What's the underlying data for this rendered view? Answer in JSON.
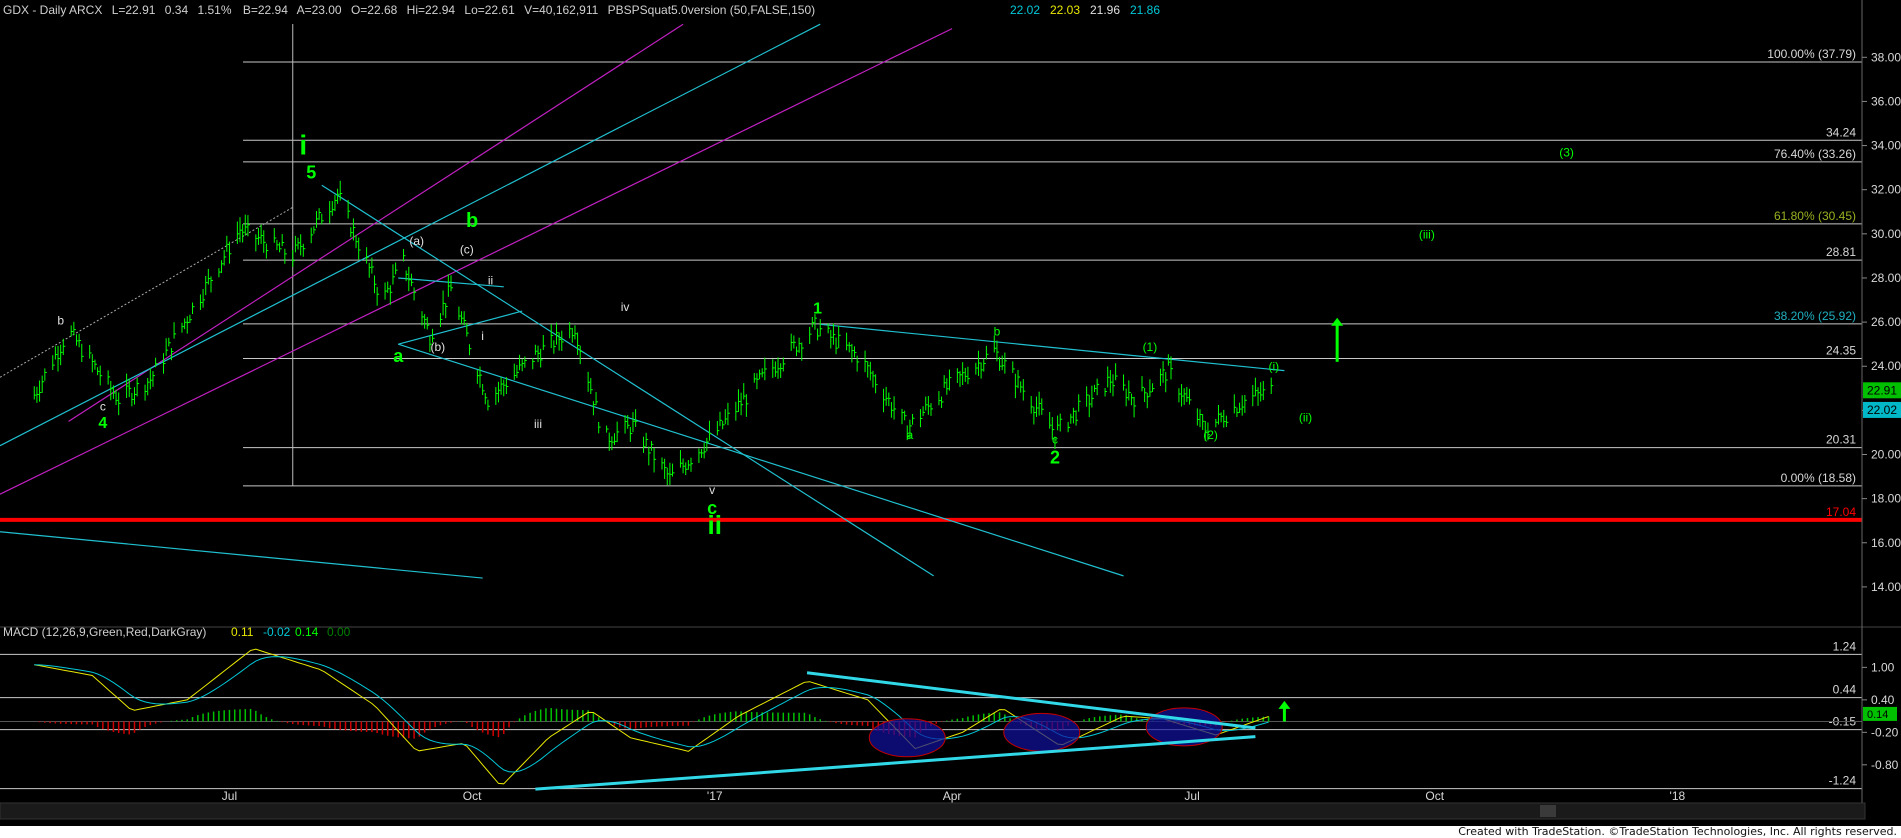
{
  "header": {
    "symbol": "GDX - Daily  ARCX",
    "last": "L=22.91",
    "change": "0.34",
    "change_pct": "1.51%",
    "bid": "B=22.94",
    "ask": "A=23.00",
    "open": "O=22.68",
    "high": "Hi=22.94",
    "low": "Lo=22.61",
    "volume": "V=40,162,911",
    "indicator": "PBSPSquat5.0version (50,FALSE,150)",
    "ind_values": [
      {
        "text": "22.02",
        "color": "#00c8d8"
      },
      {
        "text": "22.03",
        "color": "#e8e800"
      },
      {
        "text": "21.96",
        "color": "#e0e0e0"
      },
      {
        "text": "21.86",
        "color": "#00c8d8"
      }
    ]
  },
  "macd_header": {
    "label": "MACD (12,26,9,Green,Red,DarkGray)",
    "values": [
      {
        "text": "0.11",
        "color": "#e8e800"
      },
      {
        "text": "-0.02",
        "color": "#00c8d8"
      },
      {
        "text": "0.14",
        "color": "#00ff00"
      },
      {
        "text": "0.00",
        "color": "#008000"
      }
    ]
  },
  "footer": {
    "text": "Created with TradeStation. ©TradeStation Technologies, Inc. All rights reserved."
  },
  "colors": {
    "background": "#000000",
    "wave_green": "#00ff00",
    "channel_cyan": "#20c0d0",
    "channel_magenta": "#c020c0",
    "support_red": "#ff0000",
    "fib_white": "#c8c8c8"
  },
  "chart_data": [
    {
      "type": "line",
      "subtype": "ohlc-daily",
      "x_ticks": [
        "Jul",
        "Oct",
        "'17",
        "Apr",
        "Jul",
        "Oct",
        "'18"
      ],
      "y_ticks": [
        14.0,
        16.0,
        18.0,
        20.0,
        22.0,
        24.0,
        26.0,
        28.0,
        30.0,
        32.0,
        34.0,
        36.0,
        38.0
      ],
      "ylim": [
        12.5,
        39.6
      ],
      "price_series_approx": [
        [
          "2016-04-18",
          22.7
        ],
        [
          "2016-05-01",
          25.6
        ],
        [
          "2016-05-20",
          22.5
        ],
        [
          "2016-06-01",
          23.4
        ],
        [
          "2016-06-20",
          27.2
        ],
        [
          "2016-07-05",
          30.2
        ],
        [
          "2016-07-25",
          29.0
        ],
        [
          "2016-08-11",
          31.8
        ],
        [
          "2016-08-28",
          27.0
        ],
        [
          "2016-09-05",
          28.7
        ],
        [
          "2016-09-15",
          25.4
        ],
        [
          "2016-09-23",
          27.5
        ],
        [
          "2016-10-07",
          22.5
        ],
        [
          "2016-10-25",
          24.5
        ],
        [
          "2016-11-09",
          25.8
        ],
        [
          "2016-11-20",
          20.7
        ],
        [
          "2016-12-01",
          21.3
        ],
        [
          "2016-12-15",
          18.9
        ],
        [
          "2016-12-31",
          20.8
        ],
        [
          "2017-01-20",
          23.6
        ],
        [
          "2017-02-08",
          25.8
        ],
        [
          "2017-02-25",
          24.4
        ],
        [
          "2017-03-15",
          21.2
        ],
        [
          "2017-03-30",
          23.0
        ],
        [
          "2017-04-17",
          24.7
        ],
        [
          "2017-05-10",
          21.0
        ],
        [
          "2017-05-31",
          23.4
        ],
        [
          "2017-06-10",
          22.5
        ],
        [
          "2017-06-22",
          23.8
        ],
        [
          "2017-07-06",
          21.1
        ],
        [
          "2017-07-20",
          22.4
        ],
        [
          "2017-07-31",
          22.91
        ]
      ],
      "horizontal_levels": [
        {
          "value": 37.79,
          "label": "100.00% (37.79)"
        },
        {
          "value": 34.24,
          "label": "34.24"
        },
        {
          "value": 33.26,
          "label": "76.40% (33.26)"
        },
        {
          "value": 30.45,
          "label": "61.80% (30.45)"
        },
        {
          "value": 28.81,
          "label": "28.81"
        },
        {
          "value": 25.92,
          "label": "38.20% (25.92)"
        },
        {
          "value": 24.35,
          "label": "24.35"
        },
        {
          "value": 20.31,
          "label": "20.31"
        },
        {
          "value": 18.58,
          "label": "0.00% (18.58)"
        },
        {
          "value": 17.04,
          "label": "17.04"
        }
      ],
      "price_badges": [
        {
          "value": 22.91,
          "label": "22.91"
        },
        {
          "value": 22.02,
          "label": "22.02"
        }
      ],
      "wave_labels": [
        {
          "text": "i",
          "date": "2016-07-29",
          "price": 33.6
        },
        {
          "text": "5",
          "date": "2016-08-01",
          "price": 32.5
        },
        {
          "text": "b",
          "date": "2016-04-28",
          "price": 25.9
        },
        {
          "text": "c",
          "date": "2016-05-14",
          "price": 22.0
        },
        {
          "text": "4",
          "date": "2016-05-14",
          "price": 21.2
        },
        {
          "text": "a",
          "date": "2016-09-03",
          "price": 24.2
        },
        {
          "text": "(a)",
          "date": "2016-09-10",
          "price": 29.5
        },
        {
          "text": "(b)",
          "date": "2016-09-18",
          "price": 24.7
        },
        {
          "text": "b",
          "date": "2016-10-01",
          "price": 30.3
        },
        {
          "text": "(c)",
          "date": "2016-09-29",
          "price": 29.1
        },
        {
          "text": "ii",
          "date": "2016-10-08",
          "price": 27.7
        },
        {
          "text": "i",
          "date": "2016-10-05",
          "price": 25.2
        },
        {
          "text": "iii",
          "date": "2016-10-26",
          "price": 21.2
        },
        {
          "text": "iv",
          "date": "2016-11-28",
          "price": 26.5
        },
        {
          "text": "v",
          "date": "2016-12-31",
          "price": 18.2
        },
        {
          "text": "c",
          "date": "2016-12-31",
          "price": 17.3
        },
        {
          "text": "ii",
          "date": "2017-01-01",
          "price": 16.4
        },
        {
          "text": "1",
          "date": "2017-02-09",
          "price": 26.4
        },
        {
          "text": "a",
          "date": "2017-03-16",
          "price": 20.7
        },
        {
          "text": "b",
          "date": "2017-04-18",
          "price": 25.4
        },
        {
          "text": "c",
          "date": "2017-05-10",
          "price": 20.5
        },
        {
          "text": "2",
          "date": "2017-05-10",
          "price": 19.6
        },
        {
          "text": "(1)",
          "date": "2017-06-15",
          "price": 24.7
        },
        {
          "text": "(2)",
          "date": "2017-07-08",
          "price": 20.7
        },
        {
          "text": "(i)",
          "date": "2017-08-01",
          "price": 23.8
        },
        {
          "text": "(ii)",
          "date": "2017-08-13",
          "price": 21.5
        },
        {
          "text": "(iii)",
          "date": "2017-09-28",
          "price": 29.8
        },
        {
          "text": "(3)",
          "date": "2017-11-20",
          "price": 33.5
        }
      ]
    },
    {
      "type": "bar",
      "subtype": "macd-histogram",
      "y_ticks": [
        1.0,
        0.4,
        -0.2,
        -0.8
      ],
      "ylim": [
        -1.45,
        1.45
      ],
      "levels": [
        {
          "value": 1.24,
          "label": "1.24"
        },
        {
          "value": 0.44,
          "label": "0.44"
        },
        {
          "value": -0.15,
          "label": "-0.15"
        },
        {
          "value": -1.24,
          "label": "-1.24"
        }
      ],
      "badge": {
        "value": 0.14,
        "label": "0.14"
      },
      "macd_approx": [
        [
          "2016-04-18",
          1.05
        ],
        [
          "2016-05-10",
          0.85
        ],
        [
          "2016-05-25",
          0.2
        ],
        [
          "2016-06-15",
          0.4
        ],
        [
          "2016-07-10",
          1.35
        ],
        [
          "2016-08-05",
          0.95
        ],
        [
          "2016-08-25",
          0.3
        ],
        [
          "2016-09-10",
          -0.55
        ],
        [
          "2016-09-28",
          -0.4
        ],
        [
          "2016-10-12",
          -1.2
        ],
        [
          "2016-10-30",
          -0.3
        ],
        [
          "2016-11-15",
          0.2
        ],
        [
          "2016-11-30",
          -0.3
        ],
        [
          "2016-12-22",
          -0.55
        ],
        [
          "2017-01-10",
          0.1
        ],
        [
          "2017-02-05",
          0.75
        ],
        [
          "2017-02-28",
          0.4
        ],
        [
          "2017-03-18",
          -0.5
        ],
        [
          "2017-04-05",
          -0.2
        ],
        [
          "2017-04-20",
          0.25
        ],
        [
          "2017-05-12",
          -0.45
        ],
        [
          "2017-06-05",
          0.1
        ],
        [
          "2017-06-20",
          0.05
        ],
        [
          "2017-07-10",
          -0.25
        ],
        [
          "2017-07-31",
          0.11
        ]
      ]
    }
  ]
}
